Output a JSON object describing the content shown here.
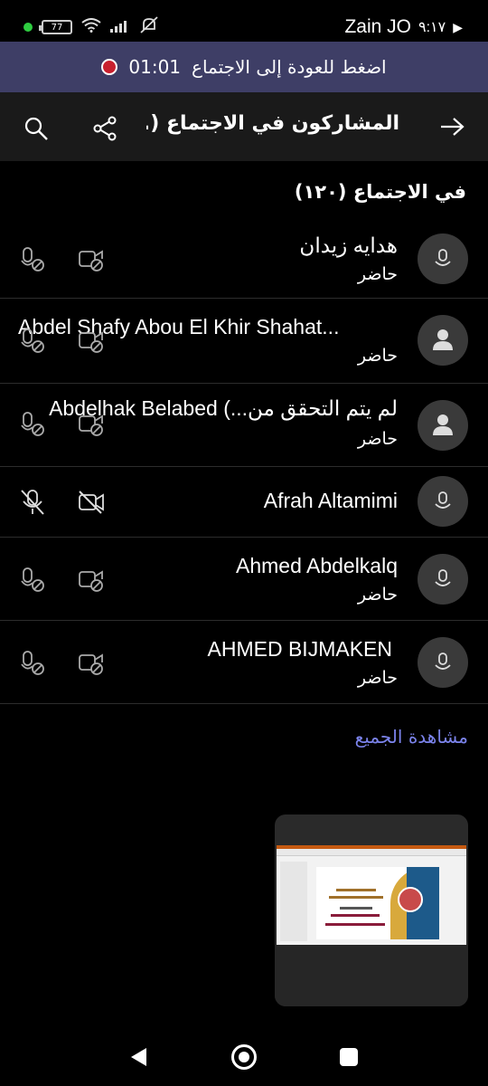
{
  "status_bar": {
    "battery": "77",
    "carrier": "Zain JO",
    "time": "٩:١٧"
  },
  "banner": {
    "text": "اضغط للعودة إلى الاجتماع",
    "timer": "01:01"
  },
  "header": {
    "title": "المشاركون في الاجتماع (..."
  },
  "section": {
    "title": "في الاجتماع (١٢٠)"
  },
  "participants": [
    {
      "name": "هدايه زيدان",
      "status": "حاضر"
    },
    {
      "name": "Abdel Shafy Abou El Khir Shahat...",
      "status": "حاضر"
    },
    {
      "name": "لم يتم التحقق من...) Abdelhak Belabed",
      "status": "حاضر"
    },
    {
      "name": "Afrah Altamimi",
      "status": ""
    },
    {
      "name": "Ahmed Abdelkalq",
      "status": "حاضر"
    },
    {
      "name": "AHMED BIJMAKEN",
      "status": "حاضر"
    }
  ],
  "see_all": "مشاهدة الجميع"
}
